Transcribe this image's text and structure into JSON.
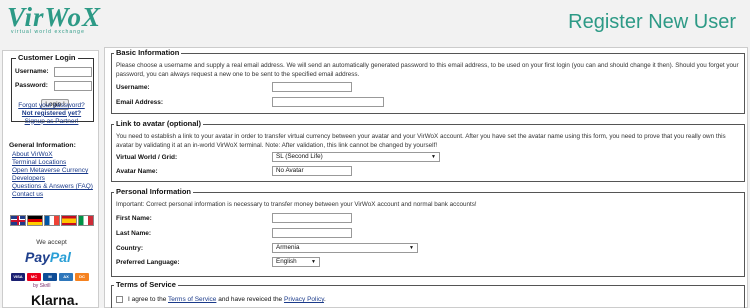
{
  "header": {
    "logo": "VirWoX",
    "tagline": "virtual world exchange",
    "title": "Register New User"
  },
  "colors": {
    "brand": "#2d9a86",
    "link": "#1a3a8a"
  },
  "sidebar": {
    "login": {
      "legend": "Customer Login",
      "username_label": "Username:",
      "password_label": "Password:",
      "login_button": "Login !",
      "forgot": "Forgot your password?",
      "not_registered": "Not registered yet?",
      "signup": "Signup as Partner!"
    },
    "general": {
      "title": "General Information:",
      "links": [
        "About VirWoX",
        "Terminal Locations",
        "Open Metaverse Currency",
        "Developers",
        "Questions & Answers (FAQ)",
        "Contact us"
      ]
    },
    "languages": [
      "english-flag",
      "german-flag",
      "french-flag",
      "spanish-flag",
      "italian-flag"
    ],
    "payment": {
      "we_accept": "We accept",
      "paypal_pay": "Pay",
      "paypal_pal": "Pal",
      "by_skrill": "by Skrill",
      "klarna": "Klarna."
    }
  },
  "sections": {
    "basic": {
      "legend": "Basic Information",
      "text": "Please choose a username and supply a real email address. We will send an automatically generated password to this email address, to be used on your first login (you can and should change it then). Should you forget your password, you can always request a new one to be sent to the specified email address.",
      "username_label": "Username:",
      "email_label": "Email Address:"
    },
    "avatar": {
      "legend": "Link to avatar (optional)",
      "text": "You need to establish a link to your avatar in order to transfer virtual currency between your avatar and your VirWoX account. After you have set the avatar name using this form, you need to prove that you really own this avatar by validating it at an in-world VirWoX terminal. Note: After validation, this link cannot be changed by yourself!",
      "world_label": "Virtual World / Grid:",
      "world_value": "SL (Second Life)",
      "avatar_label": "Avatar Name:",
      "avatar_value": "No Avatar"
    },
    "personal": {
      "legend": "Personal Information",
      "text": "Important: Correct personal information is necessary to transfer money between your VirWoX account and normal bank accounts!",
      "first_label": "First Name:",
      "last_label": "Last Name:",
      "country_label": "Country:",
      "country_value": "Armenia",
      "language_label": "Preferred Language:",
      "language_value": "English"
    },
    "tos": {
      "legend": "Terms of Service",
      "text_a": "I agree to the ",
      "link_tos": "Terms of Service",
      "text_b": " and have reveiced the ",
      "link_privacy": "Privacy Policy",
      "text_c": "."
    }
  }
}
